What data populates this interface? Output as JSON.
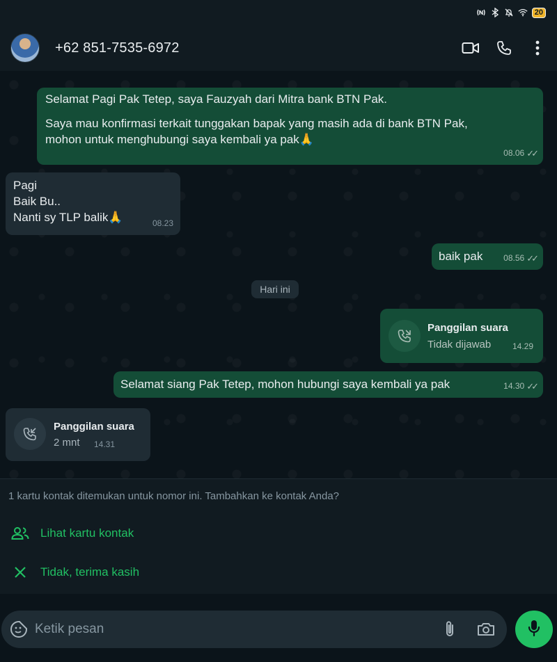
{
  "status_bar": {
    "battery_level": "20"
  },
  "header": {
    "contact_title": "+62 851-7535-6972"
  },
  "messages": [
    {
      "direction": "out",
      "lines": [
        "Selamat Pagi Pak Tetep, saya Fauzyah dari Mitra bank BTN Pak.",
        "",
        "Saya mau konfirmasi terkait tunggakan bapak yang masih ada di bank BTN Pak,",
        "mohon untuk menghubungi saya kembali ya pak🙏"
      ],
      "time": "08.06",
      "status": "read"
    },
    {
      "direction": "in",
      "lines": [
        "Pagi",
        "Baik Bu..",
        "Nanti sy TLP balik🙏"
      ],
      "time": "08.23"
    },
    {
      "direction": "out",
      "lines": [
        "baik pak"
      ],
      "time": "08.56",
      "status": "read"
    },
    {
      "direction": "out",
      "type": "call",
      "call_title": "Panggilan suara",
      "call_status": "Tidak dijawab",
      "time": "14.29"
    },
    {
      "direction": "out",
      "lines": [
        "Selamat siang Pak Tetep, mohon hubungi saya kembali ya pak"
      ],
      "time": "14.30",
      "status": "read"
    },
    {
      "direction": "in",
      "type": "call",
      "call_title": "Panggilan suara",
      "call_status": "2 mnt",
      "time": "14.31"
    }
  ],
  "date_divider": "Hari ini",
  "contact_prompt": {
    "text": "1 kartu kontak ditemukan untuk nomor ini. Tambahkan ke kontak Anda?",
    "view_card_label": "Lihat kartu kontak",
    "dismiss_label": "Tidak, terima kasih"
  },
  "composer": {
    "placeholder": "Ketik pesan"
  },
  "colors": {
    "outgoing_bubble": "#144d37",
    "incoming_bubble": "#1f2c34",
    "accent_green": "#21c063",
    "background": "#0b141a"
  }
}
